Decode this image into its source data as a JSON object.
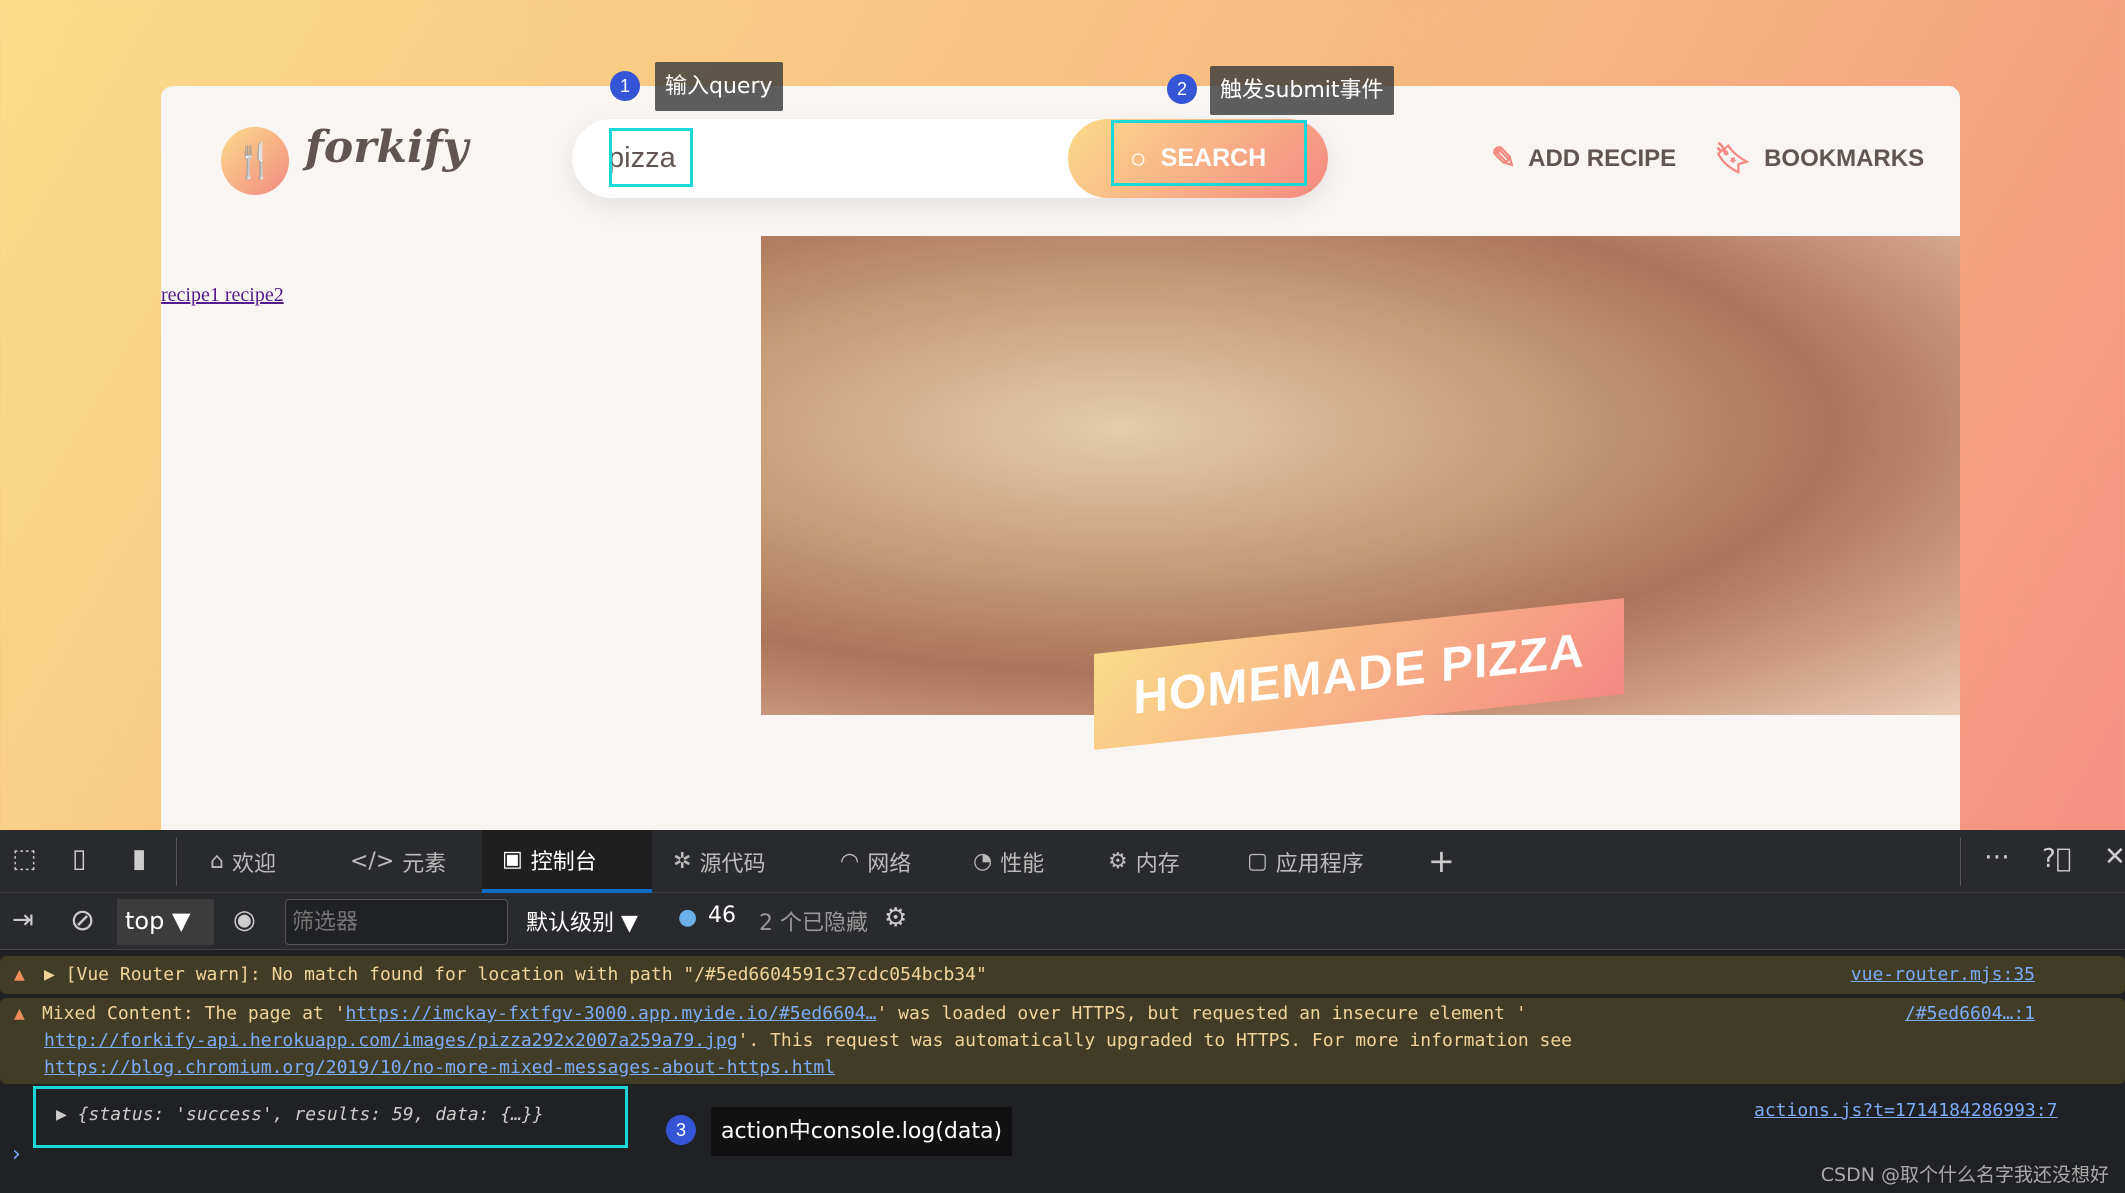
{
  "header": {
    "logo_text": "forkify",
    "search_value": "pizza",
    "search_button": "SEARCH",
    "add_recipe": "ADD RECIPE",
    "bookmarks": "BOOKMARKS"
  },
  "annotations": [
    {
      "num": "1",
      "text": "输入query"
    },
    {
      "num": "2",
      "text": "触发submit事件"
    },
    {
      "num": "3",
      "text": "action中console.log(data)"
    }
  ],
  "results": {
    "links": "recipe1 recipe2"
  },
  "recipe": {
    "title": "HOMEMADE PIZZA"
  },
  "devtools": {
    "tabs": [
      {
        "label": "欢迎",
        "icon": "home-icon"
      },
      {
        "label": "元素",
        "icon": "code-icon"
      },
      {
        "label": "控制台",
        "icon": "console-icon"
      },
      {
        "label": "源代码",
        "icon": "bug-icon"
      },
      {
        "label": "网络",
        "icon": "wifi-icon"
      },
      {
        "label": "性能",
        "icon": "gauge-icon"
      },
      {
        "label": "内存",
        "icon": "chip-icon"
      },
      {
        "label": "应用程序",
        "icon": "window-icon"
      }
    ],
    "context": "top",
    "filter_placeholder": "筛选器",
    "level": "默认级别",
    "message_count": "46",
    "hidden": "2 个已隐藏",
    "messages": [
      {
        "type": "warning",
        "text": "▶ [Vue Router warn]: No match found for location with path \"/#5ed6604591c37cdc054bcb34\"",
        "source": "vue-router.mjs:35"
      },
      {
        "type": "warning",
        "t1": "Mixed Content: The page at '",
        "u1": "https://imckay-fxtfgv-3000.app.myide.io/#5ed6604…",
        "t2": "' was loaded over HTTPS, but requested an insecure element '",
        "u2": "http://forkify-api.herokuapp.com/images/pizza292x2007a259a79.jpg",
        "t3": "'. This request was automatically upgraded to HTTPS. For more information see",
        "u3": "https://blog.chromium.org/2019/10/no-more-mixed-messages-about-https.html",
        "source": "/#5ed6604…:1"
      },
      {
        "type": "log",
        "text": "{status: 'success', results: 59, data: {…}}",
        "source": "actions.js?t=1714184286993:7"
      }
    ]
  },
  "watermark": "CSDN @取个什么名字我还没想好",
  "colors": {
    "accent": "#f48982",
    "accent2": "#fbdb89",
    "highlight": "#19d8d8",
    "active_tab": "#0a6ec7"
  }
}
